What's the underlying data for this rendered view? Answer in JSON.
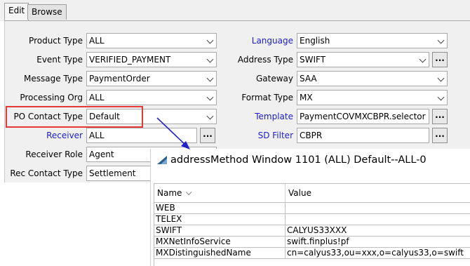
{
  "tabs": [
    {
      "label": "Edit",
      "active": true
    },
    {
      "label": "Browse",
      "active": false
    }
  ],
  "form": {
    "left": [
      {
        "label": "Product Type",
        "value": "ALL"
      },
      {
        "label": "Event Type",
        "value": "VERIFIED_PAYMENT"
      },
      {
        "label": "Message Type",
        "value": "PaymentOrder"
      },
      {
        "label": "Processing Org",
        "value": "ALL"
      },
      {
        "label": "PO Contact Type",
        "value": "Default"
      },
      {
        "label": "Receiver",
        "value": "ALL",
        "button": "..."
      },
      {
        "label": "Receiver Role",
        "value": "Agent"
      },
      {
        "label": "Rec Contact Type",
        "value": "Settlement"
      }
    ],
    "right": [
      {
        "label": "Language",
        "value": "English"
      },
      {
        "label": "Address Type",
        "value": "SWIFT",
        "button": "..."
      },
      {
        "label": "Gateway",
        "value": "SAA"
      },
      {
        "label": "Format Type",
        "value": "MX"
      },
      {
        "label": "Template",
        "value": "PaymentCOVMXCBPR.selector",
        "button": "..."
      },
      {
        "label": "SD Filter",
        "value": "CBPR",
        "button": "..."
      }
    ]
  },
  "popup": {
    "title": "addressMethod Window 1101 (ALL) Default--ALL-0",
    "columns": {
      "name": "Name",
      "value": "Value"
    },
    "rows": [
      {
        "name": "WEB",
        "value": ""
      },
      {
        "name": "TELEX",
        "value": ""
      },
      {
        "name": "SWIFT",
        "value": "CALYUS33XXX"
      },
      {
        "name": "MXNetInfoService",
        "value": "swift.finplus!pf"
      },
      {
        "name": "MXDistinguishedName",
        "value": "cn=calyus33,ou=xxx,o=calyus33,o=swift"
      }
    ]
  },
  "colors": {
    "link_label": "#2020c8",
    "highlight": "#e53935",
    "arrow": "#2222cc"
  }
}
